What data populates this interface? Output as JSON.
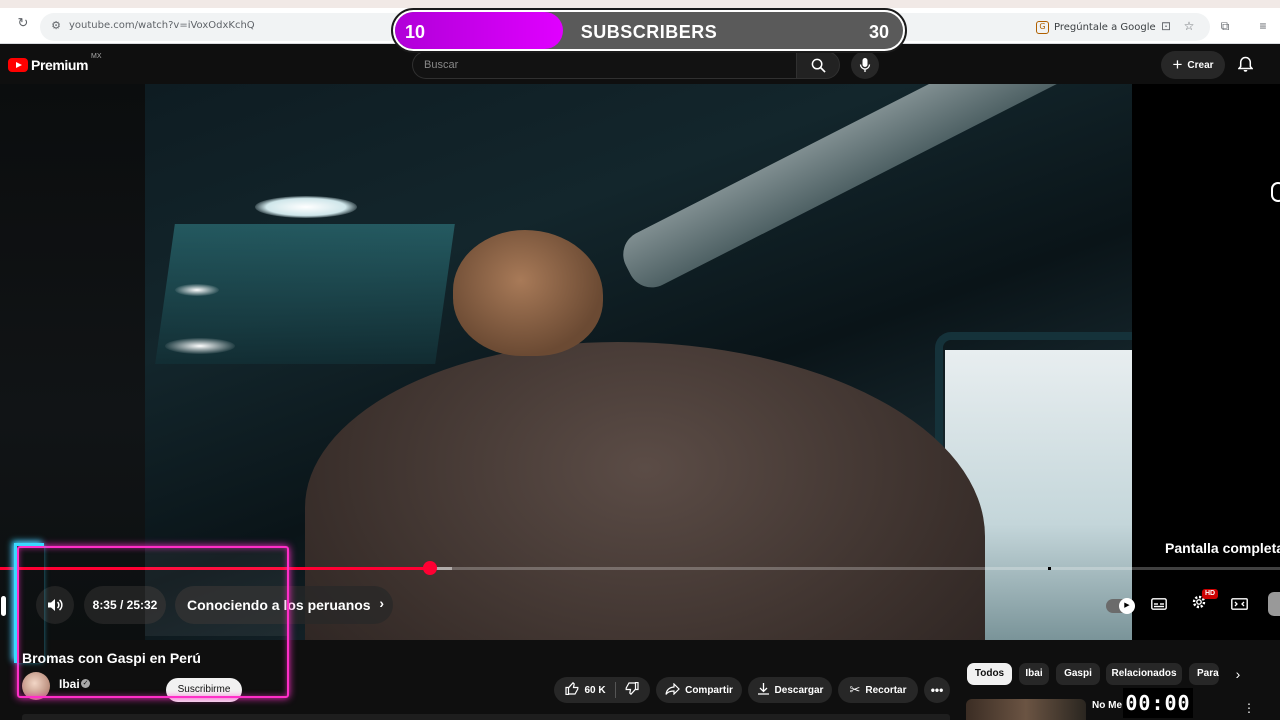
{
  "browser": {
    "url": "youtube.com/watch?v=iVoxOdxKchQ",
    "ask_google": "Pregúntale a Google"
  },
  "subscriber_goal": {
    "current_label": "10",
    "label": "SUBSCRIBERS",
    "goal_label": "30",
    "progress": 0.33,
    "fill_color": "#d100f5"
  },
  "youtube_header": {
    "logo": "Premium",
    "region": "MX",
    "search_placeholder": "Buscar",
    "create_label": "Crear"
  },
  "player": {
    "fullscreen_tooltip": "Pantalla completa",
    "time": "8:35 / 25:32",
    "chapter": "Conociendo a los peruanos",
    "progress": 0.336,
    "buffered": 0.353,
    "hd_badge": "HD",
    "accent_color": "#ff0033"
  },
  "video": {
    "title": "Bromas con Gaspi en Perú",
    "channel": "Ibai",
    "subscribe": "Suscribirme"
  },
  "actions": {
    "likes": "60 K",
    "share": "Compartir",
    "download": "Descargar",
    "clip": "Recortar"
  },
  "chips": [
    "Todos",
    "Ibai",
    "Gaspi",
    "Relacionados",
    "Para"
  ],
  "recommendation": {
    "title": "No Me"
  },
  "timer_overlay": "00:00"
}
